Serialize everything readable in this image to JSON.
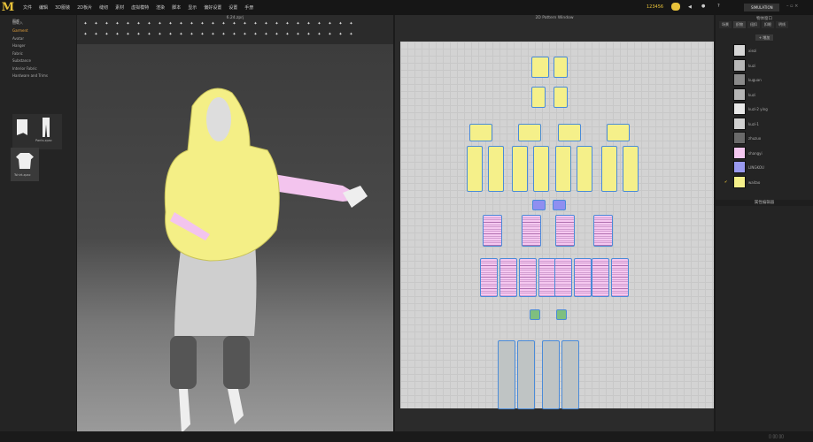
{
  "app": {
    "logo": "M",
    "menu": [
      "文件",
      "编辑",
      "3D服装",
      "2D板片",
      "缝纫",
      "素材",
      "虚拟模特",
      "渲染",
      "脚本",
      "显示",
      "偏好设置",
      "设置",
      "手册"
    ],
    "points": "123456",
    "mode": "SIMULATION"
  },
  "library": {
    "title": "图库",
    "header": "加载入",
    "items": [
      "Garment",
      "Avatar",
      "Hanger",
      "Fabric",
      "Substance",
      "Interior Fabric",
      "Hardware and Trims"
    ],
    "selected": 0,
    "files": [
      "",
      "Pants.zpac",
      "Tshirt.zpac"
    ]
  },
  "viewport3d": {
    "title": "6.24.zprj"
  },
  "pattern2d": {
    "title": "2D Pattern Window"
  },
  "objectBrowser": {
    "title": "物体窗口",
    "tabs": [
      "场景",
      "织物",
      "纽扣",
      "扣眼",
      "明线"
    ],
    "add_label": "+ 增加",
    "fabrics": [
      {
        "name": "xiezi",
        "color": "#d6d6d6"
      },
      {
        "name": "kuzi",
        "color": "#b8b8b8"
      },
      {
        "name": "kuguan",
        "color": "#8a8a8a"
      },
      {
        "name": "kuzi",
        "color": "#b5b5b5"
      },
      {
        "name": "kuzi-2 ying",
        "color": "#e8e8e8"
      },
      {
        "name": "kuzi-1",
        "color": "#d0d0d0"
      },
      {
        "name": "zhuzuo",
        "color": "#6a6a6a"
      },
      {
        "name": "shangyi",
        "color": "#f5c8f0"
      },
      {
        "name": "LINGKOU",
        "color": "#9a9af0"
      },
      {
        "name": "waitao",
        "color": "#f5f08a"
      }
    ],
    "selected": 9,
    "props_title": "属性编辑器"
  },
  "colors": {
    "accent": "#e8c23a",
    "garment_yellow": "#f5f08a",
    "garment_pink": "#f5c8f0",
    "seam_blue": "#4a8bd8"
  }
}
